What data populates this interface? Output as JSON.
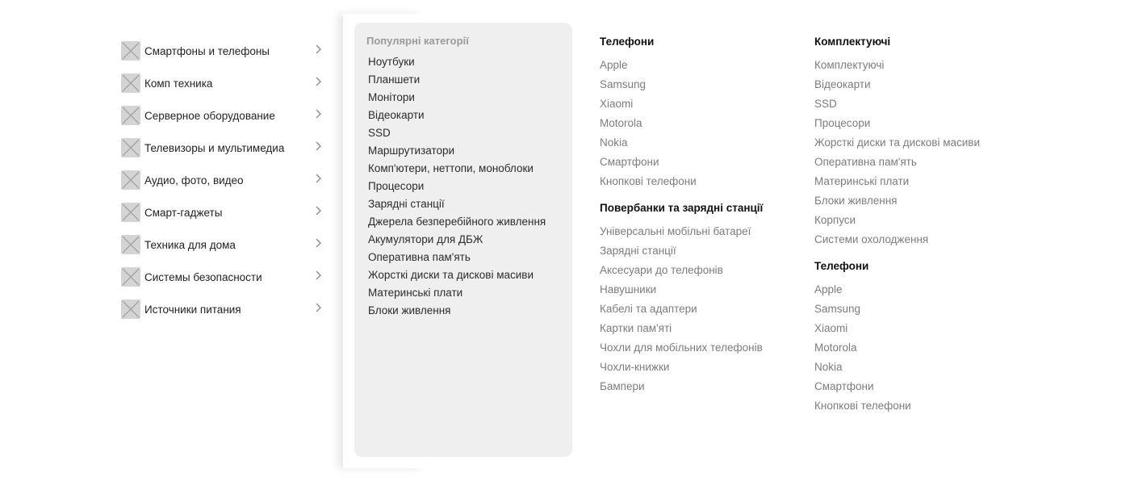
{
  "categories": [
    {
      "label": "Смартфоны и телефоны"
    },
    {
      "label": "Комп техника"
    },
    {
      "label": "Серверное оборудование"
    },
    {
      "label": "Телевизоры и мультимедиа"
    },
    {
      "label": "Аудио, фото, видео"
    },
    {
      "label": "Смарт-гаджеты"
    },
    {
      "label": "Техника для дома"
    },
    {
      "label": "Системы безопасности"
    },
    {
      "label": "Источники питания"
    }
  ],
  "popular": {
    "title": "Популярні категорії",
    "items": [
      "Ноутбуки",
      "Планшети",
      "Монітори",
      "Відеокарти",
      "SSD",
      "Маршрутизатори",
      "Комп'ютери, неттопи, моноблоки",
      "Процесори",
      "Зарядні станції",
      "Джерела безперебійного живлення",
      "Акумулятори для ДБЖ",
      "Оперативна пам'ять",
      "Жорсткі диски та дискові масиви",
      "Материнські плати",
      "Блоки живлення"
    ]
  },
  "columns": [
    {
      "groups": [
        {
          "title": "Телефони",
          "items": [
            "Apple",
            "Samsung",
            "Xiaomi",
            "Motorola",
            "Nokia",
            "Смартфони",
            "Кнопкові телефони"
          ]
        },
        {
          "title": "Повербанки та зарядні станції",
          "items": [
            "Універсальні мобільні батареї",
            "Зарядні станції",
            "Аксесуари до телефонів",
            "Навушники",
            "Кабелі та адаптери",
            "Картки пам'яті",
            "Чохли для мобільних телефонів",
            "Чохли-книжки",
            "Бампери"
          ]
        }
      ]
    },
    {
      "groups": [
        {
          "title": "Комплектуючі",
          "items": [
            "Комплектуючі",
            "Відеокарти",
            "SSD",
            "Процесори",
            "Жорсткі диски та дискові масиви",
            "Оперативна пам'ять",
            "Материнські плати",
            "Блоки живлення",
            "Корпуси",
            "Системи охолодження"
          ]
        },
        {
          "title": "Телефони",
          "items": [
            "Apple",
            "Samsung",
            "Xiaomi",
            "Motorola",
            "Nokia",
            "Смартфони",
            "Кнопкові телефони"
          ]
        }
      ]
    }
  ],
  "icons": {
    "category_thumb": "image-placeholder-icon",
    "chevron": "chevron-right-icon"
  },
  "colors": {
    "thumb": "#d4d4d4",
    "popular_bg": "#efefef",
    "muted_text": "#7c7c7c"
  }
}
